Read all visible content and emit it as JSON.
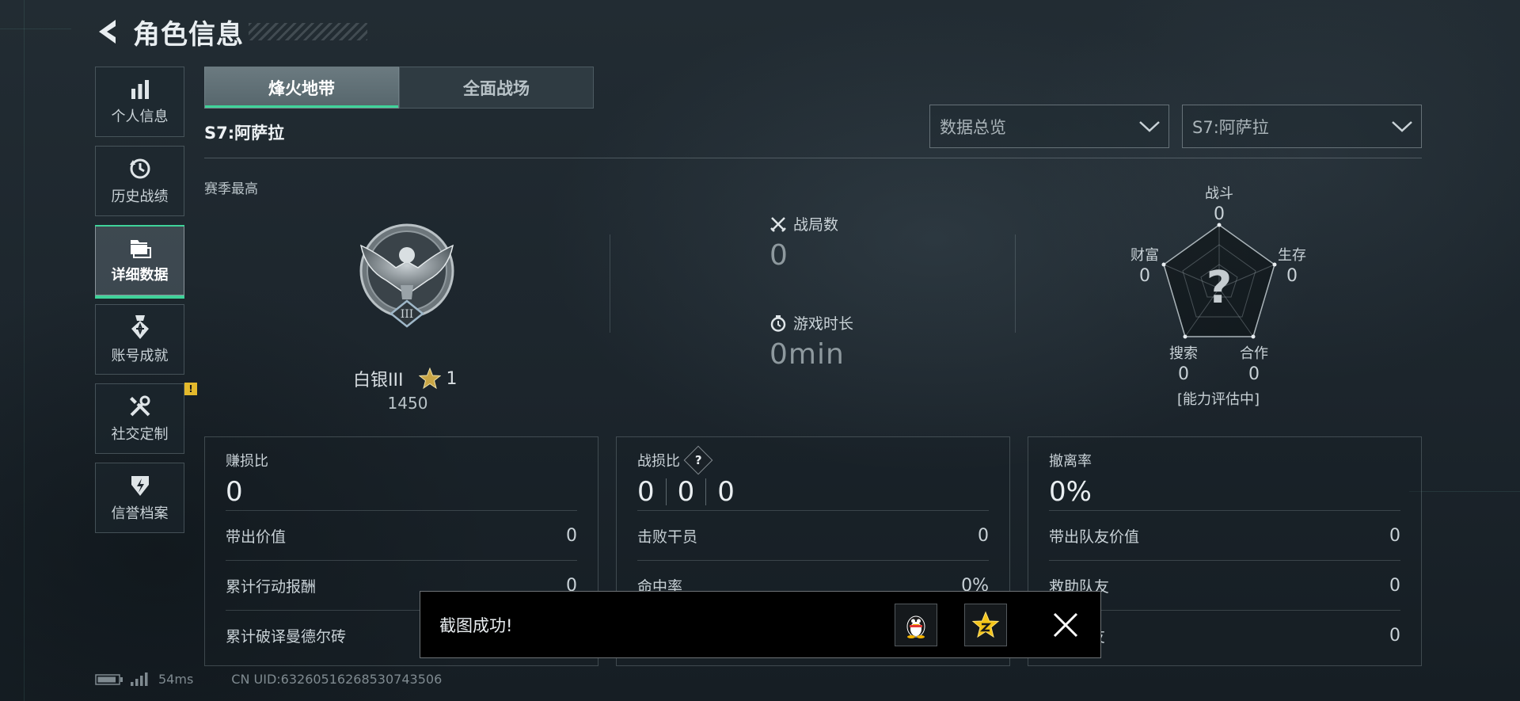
{
  "header": {
    "title": "角色信息"
  },
  "sidebar": {
    "items": [
      {
        "label": "个人信息"
      },
      {
        "label": "历史战绩"
      },
      {
        "label": "详细数据"
      },
      {
        "label": "账号成就"
      },
      {
        "label": "社交定制",
        "badge": "!"
      },
      {
        "label": "信誉档案"
      }
    ]
  },
  "tabs": [
    {
      "label": "烽火地带"
    },
    {
      "label": "全面战场"
    }
  ],
  "season": {
    "label": "S7:阿萨拉"
  },
  "dropdowns": {
    "view": "数据总览",
    "season": "S7:阿萨拉"
  },
  "rank": {
    "section_label": "赛季最高",
    "tier": "白银III",
    "medal_numeral": "III",
    "stars": "1",
    "score": "1450"
  },
  "stats": {
    "matches_label": "战局数",
    "matches_value": "0",
    "playtime_label": "游戏时长",
    "playtime_value": "0min"
  },
  "radar": {
    "center": "?",
    "axes": [
      {
        "label": "战斗",
        "value": "0"
      },
      {
        "label": "生存",
        "value": "0"
      },
      {
        "label": "合作",
        "value": "0"
      },
      {
        "label": "搜索",
        "value": "0"
      },
      {
        "label": "财富",
        "value": "0"
      }
    ],
    "status": "[能力评估中]"
  },
  "panels": [
    {
      "title": "赚损比",
      "value": "0",
      "rows": [
        {
          "label": "带出价值",
          "value": "0"
        },
        {
          "label": "累计行动报酬",
          "value": "0"
        },
        {
          "label": "累计破译曼德尔砖",
          "value": ""
        }
      ]
    },
    {
      "title": "战损比",
      "help": "?",
      "values": [
        "0",
        "0",
        "0"
      ],
      "rows": [
        {
          "label": "击败干员",
          "value": "0"
        },
        {
          "label": "命中率",
          "value": "0%"
        },
        {
          "label": "",
          "value": ""
        }
      ]
    },
    {
      "title": "撤离率",
      "value": "0%",
      "rows": [
        {
          "label": "带出队友价值",
          "value": "0"
        },
        {
          "label": "救助队友",
          "value": "0"
        },
        {
          "label": "友",
          "value": "0"
        }
      ]
    }
  ],
  "toast": {
    "message": "截图成功!"
  },
  "statusbar": {
    "ping": "54ms",
    "uid": "CN UID:63260516268530743506",
    "battery_level": 0.9
  },
  "colors": {
    "accent": "#3fd39a",
    "badge": "#e4b92c"
  }
}
